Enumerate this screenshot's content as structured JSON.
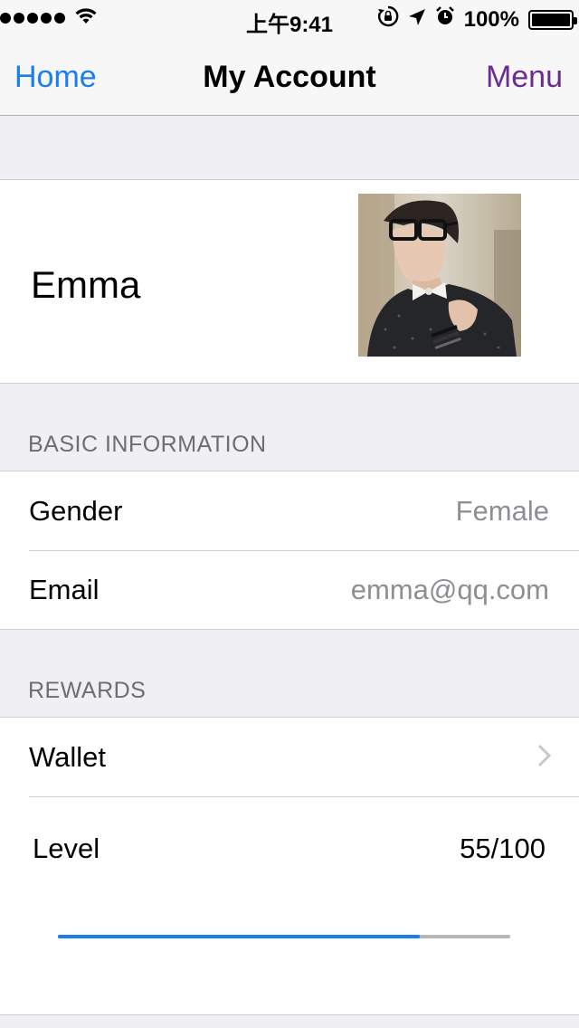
{
  "status_bar": {
    "signal_dots": 5,
    "time": "上午9:41",
    "battery_text": "100%",
    "icons": [
      "signal-dots-icon",
      "wifi-icon",
      "rotation-lock-icon",
      "location-arrow-icon",
      "alarm-icon",
      "battery-icon"
    ]
  },
  "nav": {
    "left_label": "Home",
    "title": "My Account",
    "right_label": "Menu",
    "left_color": "#1a7df0",
    "right_color": "#6a2c91"
  },
  "profile": {
    "name": "Emma"
  },
  "basic_information": {
    "header": "BASIC INFORMATION",
    "rows": [
      {
        "label": "Gender",
        "value": "Female"
      },
      {
        "label": "Email",
        "value": "emma@qq.com"
      }
    ]
  },
  "rewards": {
    "header": "REWARDS",
    "wallet_label": "Wallet",
    "level_label": "Level",
    "level_value": "55/100",
    "level_progress": 0.8
  },
  "colors": {
    "accent": "#1a7df0",
    "background": "#efeff4",
    "secondary_text": "#8e8e93"
  }
}
